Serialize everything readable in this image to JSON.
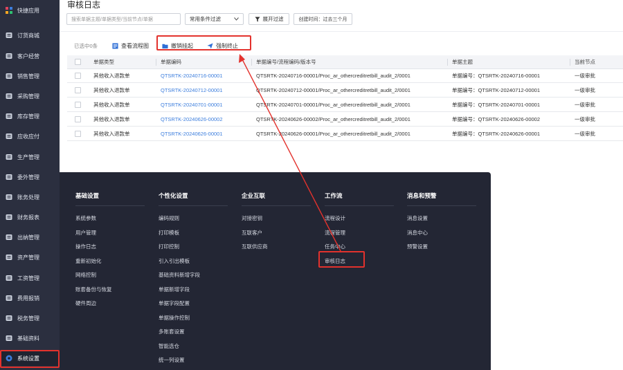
{
  "sidebar": {
    "items": [
      {
        "label": "快捷应用",
        "icon": "grid-apps-icon"
      },
      {
        "label": "订货商城",
        "icon": "store-icon"
      },
      {
        "label": "客户经营",
        "icon": "customer-icon"
      },
      {
        "label": "销售管理",
        "icon": "sales-icon"
      },
      {
        "label": "采购管理",
        "icon": "purchase-icon"
      },
      {
        "label": "库存管理",
        "icon": "warehouse-icon"
      },
      {
        "label": "应收应付",
        "icon": "coin-icon"
      },
      {
        "label": "生产管理",
        "icon": "factory-icon"
      },
      {
        "label": "委外管理",
        "icon": "outsource-icon"
      },
      {
        "label": "账务处理",
        "icon": "ledger-icon"
      },
      {
        "label": "财务报表",
        "icon": "report-icon"
      },
      {
        "label": "出纳管理",
        "icon": "cashier-icon"
      },
      {
        "label": "资产管理",
        "icon": "asset-icon"
      },
      {
        "label": "工资管理",
        "icon": "salary-icon"
      },
      {
        "label": "费用报销",
        "icon": "expense-icon"
      },
      {
        "label": "税务管理",
        "icon": "tax-icon"
      },
      {
        "label": "基础资料",
        "icon": "layers-icon"
      },
      {
        "label": "系统设置",
        "icon": "settings-icon"
      }
    ]
  },
  "header": {
    "title": "审核日志",
    "search_placeholder": "搜索单据主题/单据类型/当前节点/单据",
    "filter_select": "常用条件过滤",
    "expand_button": "展开过滤",
    "date_filter": "创建时间：过去三个月"
  },
  "actions": {
    "selected": "已选中0条",
    "view_flow": "查看流程图",
    "withdraw": "撤销挂起",
    "terminate": "强制终止"
  },
  "table": {
    "columns": [
      "单据类型",
      "单据编码",
      "单据编号/流程编码/版本号",
      "单据主题",
      "当前节点"
    ],
    "rows": [
      [
        "其他收入退款单",
        "QTSRTK-20240716-00001",
        "QTSRTK-20240716-00001/Proc_ar_othercreditretbill_audit_2/0001",
        "单据编号：QTSRTK-20240716-00001",
        "一级审批"
      ],
      [
        "其他收入退款单",
        "QTSRTK-20240712-00001",
        "QTSRTK-20240712-00001/Proc_ar_othercreditretbill_audit_2/0001",
        "单据编号：QTSRTK-20240712-00001",
        "一级审批"
      ],
      [
        "其他收入退款单",
        "QTSRTK-20240701-00001",
        "QTSRTK-20240701-00001/Proc_ar_othercreditretbill_audit_2/0001",
        "单据编号：QTSRTK-20240701-00001",
        "一级审批"
      ],
      [
        "其他收入退款单",
        "QTSRTK-20240626-00002",
        "QTSRTK-20240626-00002/Proc_ar_othercreditretbill_audit_2/0001",
        "单据编号：QTSRTK-20240626-00002",
        "一级审批"
      ],
      [
        "其他收入退款单",
        "QTSRTK-20240626-00001",
        "QTSRTK-20240626-00001/Proc_ar_othercreditretbill_audit_2/0001",
        "单据编号：QTSRTK-20240626-00001",
        "一级审批"
      ]
    ]
  },
  "menu": {
    "columns": [
      {
        "title": "基础设置",
        "items": [
          "系统参数",
          "用户管理",
          "操作日志",
          "重新初始化",
          "网络控制",
          "账套备份与恢复",
          "硬件周边"
        ]
      },
      {
        "title": "个性化设置",
        "items": [
          "编码规则",
          "打印模板",
          "打印控制",
          "引入引出模板",
          "基础资料新增字段",
          "单据新增字段",
          "单据字段配置",
          "单据操作控制",
          "多账套设置",
          "智能选仓",
          "统一列设置"
        ]
      },
      {
        "title": "企业互联",
        "items": [
          "对接密钥",
          "互联客户",
          "互联供应商"
        ]
      },
      {
        "title": "工作流",
        "items": [
          "流程设计",
          "流程管理",
          "任务中心",
          "审核日志"
        ]
      },
      {
        "title": "消息和预警",
        "items": [
          "消息设置",
          "消息中心",
          "预警设置"
        ]
      }
    ]
  },
  "colors": {
    "sidebar_bg": "#2b2f3f",
    "menu_bg": "#232634",
    "link": "#3b7ddd",
    "highlight": "#e3322d"
  }
}
